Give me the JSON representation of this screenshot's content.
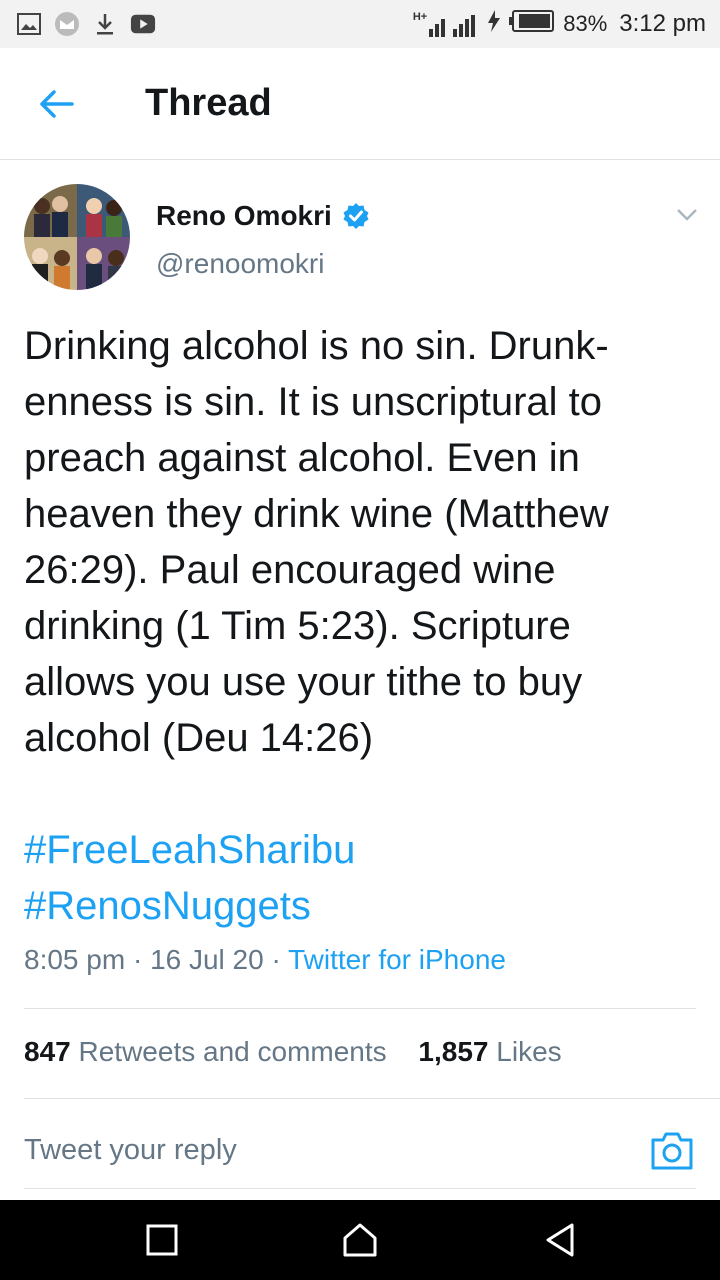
{
  "status_bar": {
    "network_label": "H+",
    "battery_percent": "83%",
    "time": "3:12 pm",
    "icons": [
      "gallery-icon",
      "messenger-icon",
      "download-icon",
      "youtube-icon",
      "signal-icon",
      "charging-icon",
      "battery-icon"
    ]
  },
  "header": {
    "title": "Thread"
  },
  "tweet": {
    "author_name": "Reno Omokri",
    "author_handle": "@renoomokri",
    "verified": true,
    "text": "Drinking alcohol is no sin. Drunk-\nenness is sin. It is unscriptural to\npreach against alcohol. Even in\nheaven they drink wine (Matthew\n26:29). Paul encouraged wine\ndrinking (1 Tim 5:23). Scripture\nallows you use your tithe to buy\nalcohol (Deu 14:26)",
    "hashtags": [
      "#FreeLeahSharibu",
      "#RenosNuggets"
    ],
    "time": "8:05 pm",
    "date": "16 Jul 20",
    "source": "Twitter for iPhone",
    "separator": "·",
    "retweets_count": "847",
    "retweets_label": "Retweets and comments",
    "likes_count": "1,857",
    "likes_label": "Likes"
  },
  "reply": {
    "placeholder": "Tweet your reply"
  },
  "colors": {
    "accent": "#1da1f2",
    "text": "#14171a",
    "muted": "#657786"
  }
}
